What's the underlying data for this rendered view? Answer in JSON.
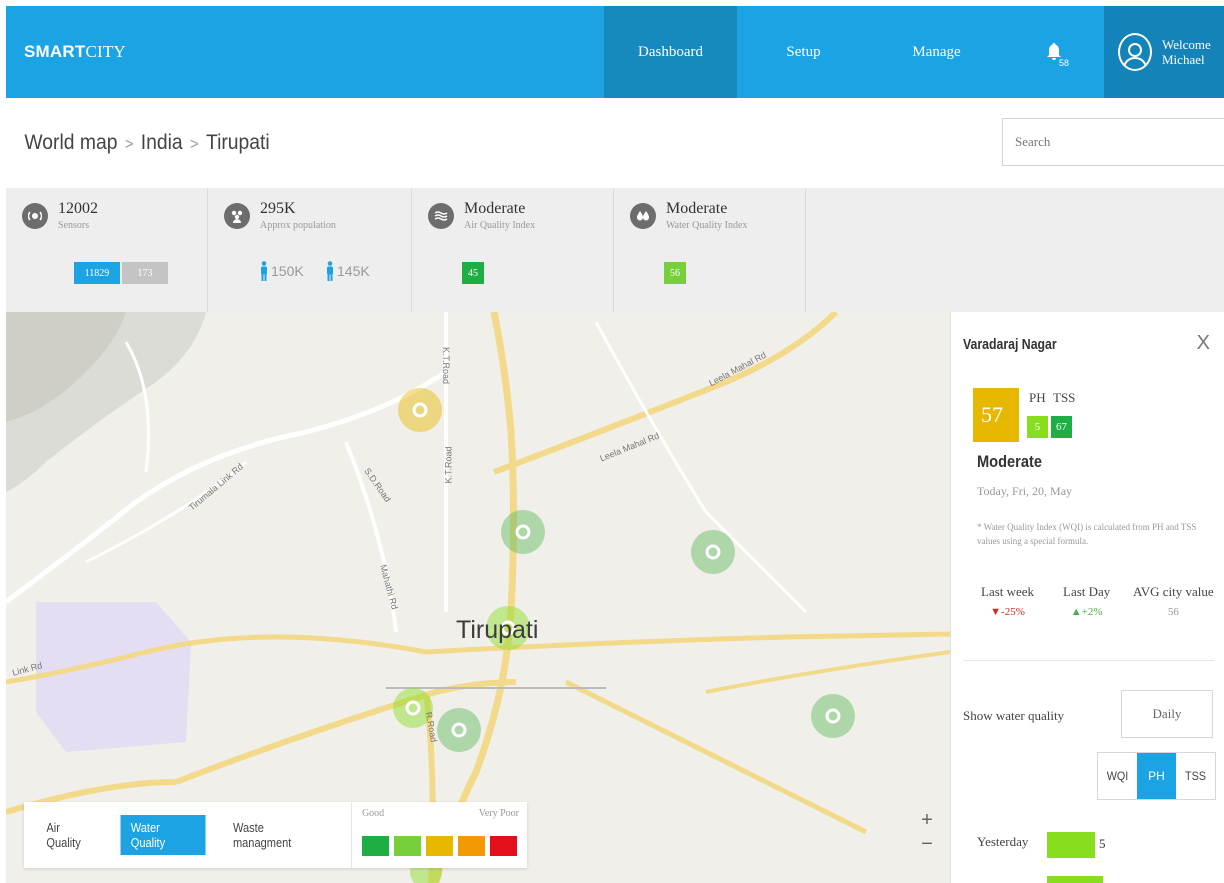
{
  "topbar": {
    "brand_bold": "SMART",
    "brand_rest": "CITY",
    "nav": [
      "Dashboard",
      "Setup",
      "Manage"
    ],
    "active_nav": "Dashboard",
    "notification_count": "58",
    "welcome_line1": "Welcome",
    "welcome_line2": "Michael"
  },
  "breadcrumb": {
    "items": [
      "World map",
      "India",
      "Tirupati"
    ],
    "search_placeholder": "Search"
  },
  "stats": {
    "sensors": {
      "value": "12002",
      "label": "Sensors",
      "active": "11829",
      "inactive": "173"
    },
    "population": {
      "value": "295K",
      "label": "Approx population",
      "male": "150K",
      "female": "145K"
    },
    "air": {
      "value": "Moderate",
      "label": "Air Quality Index",
      "score": "45"
    },
    "water": {
      "value": "Moderate",
      "label": "Water Quality Index",
      "score": "56"
    }
  },
  "map": {
    "city": "Tirupati",
    "roads": [
      "K.T.Road",
      "Leela Mahal Rd",
      "Leela Mahal Rd",
      "Tirumala Link Rd",
      "S.D.Road",
      "K.T.Road",
      "Mahathi Rd",
      "R.Road",
      "Link Rd"
    ],
    "zoom_in": "+",
    "zoom_out": "−"
  },
  "filter": {
    "tabs": [
      "Air Quality",
      "Water Quality",
      "Waste managment"
    ],
    "active": "Water Quality",
    "legend_left": "Good",
    "legend_right": "Very Poor",
    "legend_colors": [
      "#1fae44",
      "#78cf3c",
      "#e6b800",
      "#f29a05",
      "#e2101b"
    ]
  },
  "panel": {
    "title": "Varadaraj Nagar",
    "close": "X",
    "score": "57",
    "ph_label": "PH",
    "tss_label": "TSS",
    "ph_value": "5",
    "tss_value": "67",
    "status": "Moderate",
    "date": "Today, Fri, 20, May",
    "note": "* Water Quality Index (WQI) is calculated from PH and TSS values using a special formula.",
    "trends": [
      {
        "label": "Last week",
        "value": "▼-25%",
        "color": "#d9281e"
      },
      {
        "label": "Last Day",
        "value": "▲+2%",
        "color": "#4cae4c"
      },
      {
        "label": "AVG city value",
        "value": "56",
        "color": "#999999"
      }
    ],
    "show_label": "Show water quality",
    "period": "Daily",
    "segments": [
      "WQI",
      "PH",
      "TSS"
    ],
    "active_segment": "PH",
    "history_label": "Yesterday",
    "history_value": "5",
    "colors": {
      "score": "#e6b800",
      "ph": "#88dd1f",
      "tss": "#1fae44"
    }
  },
  "theme": {
    "primary": "#1ba3e3",
    "primary_dark": "#1689bf"
  }
}
